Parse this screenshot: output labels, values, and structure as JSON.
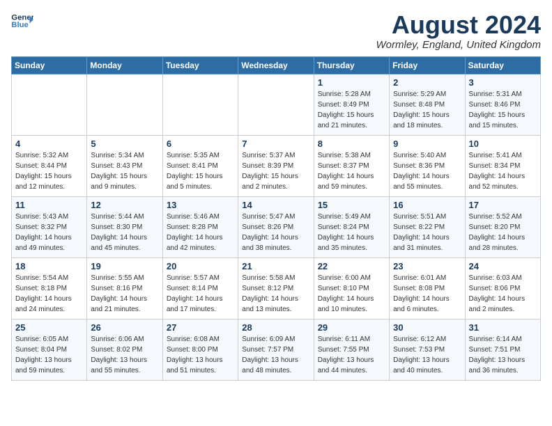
{
  "header": {
    "logo_line1": "General",
    "logo_line2": "Blue",
    "month_year": "August 2024",
    "location": "Wormley, England, United Kingdom"
  },
  "weekdays": [
    "Sunday",
    "Monday",
    "Tuesday",
    "Wednesday",
    "Thursday",
    "Friday",
    "Saturday"
  ],
  "weeks": [
    [
      {
        "day": "",
        "info": ""
      },
      {
        "day": "",
        "info": ""
      },
      {
        "day": "",
        "info": ""
      },
      {
        "day": "",
        "info": ""
      },
      {
        "day": "1",
        "info": "Sunrise: 5:28 AM\nSunset: 8:49 PM\nDaylight: 15 hours\nand 21 minutes."
      },
      {
        "day": "2",
        "info": "Sunrise: 5:29 AM\nSunset: 8:48 PM\nDaylight: 15 hours\nand 18 minutes."
      },
      {
        "day": "3",
        "info": "Sunrise: 5:31 AM\nSunset: 8:46 PM\nDaylight: 15 hours\nand 15 minutes."
      }
    ],
    [
      {
        "day": "4",
        "info": "Sunrise: 5:32 AM\nSunset: 8:44 PM\nDaylight: 15 hours\nand 12 minutes."
      },
      {
        "day": "5",
        "info": "Sunrise: 5:34 AM\nSunset: 8:43 PM\nDaylight: 15 hours\nand 9 minutes."
      },
      {
        "day": "6",
        "info": "Sunrise: 5:35 AM\nSunset: 8:41 PM\nDaylight: 15 hours\nand 5 minutes."
      },
      {
        "day": "7",
        "info": "Sunrise: 5:37 AM\nSunset: 8:39 PM\nDaylight: 15 hours\nand 2 minutes."
      },
      {
        "day": "8",
        "info": "Sunrise: 5:38 AM\nSunset: 8:37 PM\nDaylight: 14 hours\nand 59 minutes."
      },
      {
        "day": "9",
        "info": "Sunrise: 5:40 AM\nSunset: 8:36 PM\nDaylight: 14 hours\nand 55 minutes."
      },
      {
        "day": "10",
        "info": "Sunrise: 5:41 AM\nSunset: 8:34 PM\nDaylight: 14 hours\nand 52 minutes."
      }
    ],
    [
      {
        "day": "11",
        "info": "Sunrise: 5:43 AM\nSunset: 8:32 PM\nDaylight: 14 hours\nand 49 minutes."
      },
      {
        "day": "12",
        "info": "Sunrise: 5:44 AM\nSunset: 8:30 PM\nDaylight: 14 hours\nand 45 minutes."
      },
      {
        "day": "13",
        "info": "Sunrise: 5:46 AM\nSunset: 8:28 PM\nDaylight: 14 hours\nand 42 minutes."
      },
      {
        "day": "14",
        "info": "Sunrise: 5:47 AM\nSunset: 8:26 PM\nDaylight: 14 hours\nand 38 minutes."
      },
      {
        "day": "15",
        "info": "Sunrise: 5:49 AM\nSunset: 8:24 PM\nDaylight: 14 hours\nand 35 minutes."
      },
      {
        "day": "16",
        "info": "Sunrise: 5:51 AM\nSunset: 8:22 PM\nDaylight: 14 hours\nand 31 minutes."
      },
      {
        "day": "17",
        "info": "Sunrise: 5:52 AM\nSunset: 8:20 PM\nDaylight: 14 hours\nand 28 minutes."
      }
    ],
    [
      {
        "day": "18",
        "info": "Sunrise: 5:54 AM\nSunset: 8:18 PM\nDaylight: 14 hours\nand 24 minutes."
      },
      {
        "day": "19",
        "info": "Sunrise: 5:55 AM\nSunset: 8:16 PM\nDaylight: 14 hours\nand 21 minutes."
      },
      {
        "day": "20",
        "info": "Sunrise: 5:57 AM\nSunset: 8:14 PM\nDaylight: 14 hours\nand 17 minutes."
      },
      {
        "day": "21",
        "info": "Sunrise: 5:58 AM\nSunset: 8:12 PM\nDaylight: 14 hours\nand 13 minutes."
      },
      {
        "day": "22",
        "info": "Sunrise: 6:00 AM\nSunset: 8:10 PM\nDaylight: 14 hours\nand 10 minutes."
      },
      {
        "day": "23",
        "info": "Sunrise: 6:01 AM\nSunset: 8:08 PM\nDaylight: 14 hours\nand 6 minutes."
      },
      {
        "day": "24",
        "info": "Sunrise: 6:03 AM\nSunset: 8:06 PM\nDaylight: 14 hours\nand 2 minutes."
      }
    ],
    [
      {
        "day": "25",
        "info": "Sunrise: 6:05 AM\nSunset: 8:04 PM\nDaylight: 13 hours\nand 59 minutes."
      },
      {
        "day": "26",
        "info": "Sunrise: 6:06 AM\nSunset: 8:02 PM\nDaylight: 13 hours\nand 55 minutes."
      },
      {
        "day": "27",
        "info": "Sunrise: 6:08 AM\nSunset: 8:00 PM\nDaylight: 13 hours\nand 51 minutes."
      },
      {
        "day": "28",
        "info": "Sunrise: 6:09 AM\nSunset: 7:57 PM\nDaylight: 13 hours\nand 48 minutes."
      },
      {
        "day": "29",
        "info": "Sunrise: 6:11 AM\nSunset: 7:55 PM\nDaylight: 13 hours\nand 44 minutes."
      },
      {
        "day": "30",
        "info": "Sunrise: 6:12 AM\nSunset: 7:53 PM\nDaylight: 13 hours\nand 40 minutes."
      },
      {
        "day": "31",
        "info": "Sunrise: 6:14 AM\nSunset: 7:51 PM\nDaylight: 13 hours\nand 36 minutes."
      }
    ]
  ]
}
